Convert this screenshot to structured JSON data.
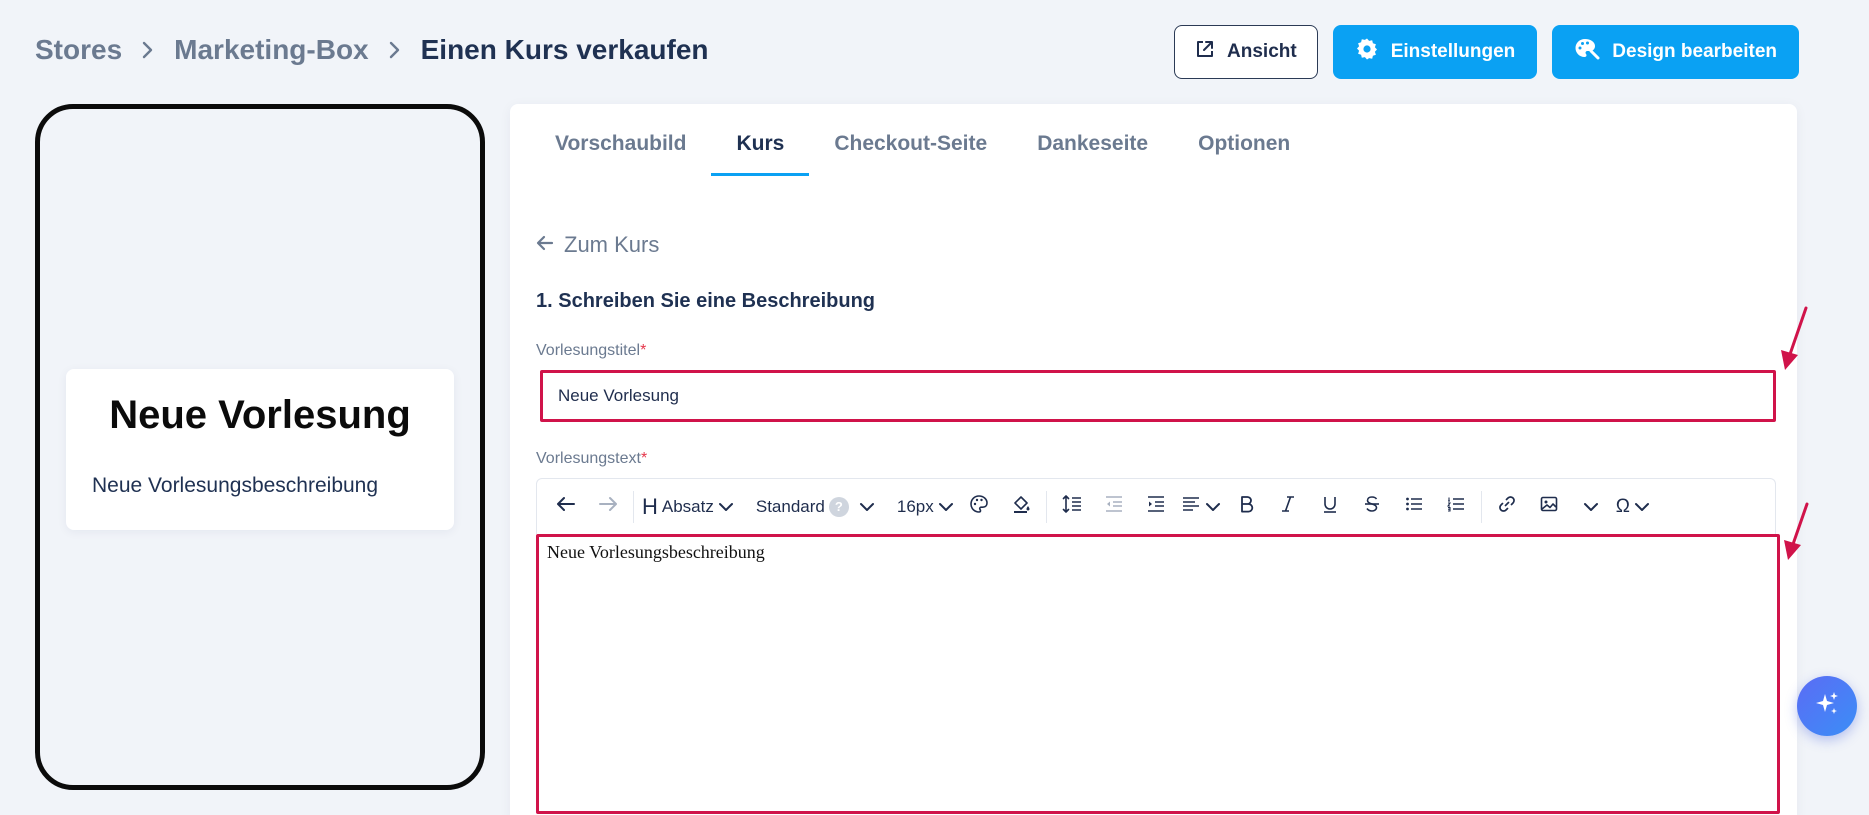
{
  "breadcrumb": {
    "items": [
      "Stores",
      "Marketing-Box",
      "Einen Kurs verkaufen"
    ]
  },
  "header": {
    "view_label": "Ansicht",
    "settings_label": "Einstellungen",
    "design_label": "Design bearbeiten"
  },
  "preview": {
    "title": "Neue Vorlesung",
    "description": "Neue Vorlesungsbeschreibung"
  },
  "tabs": [
    {
      "label": "Vorschaubild",
      "active": false
    },
    {
      "label": "Kurs",
      "active": true
    },
    {
      "label": "Checkout-Seite",
      "active": false
    },
    {
      "label": "Dankeseite",
      "active": false
    },
    {
      "label": "Optionen",
      "active": false
    }
  ],
  "form": {
    "back_label": "Zum Kurs",
    "section_title": "1. Schreiben Sie eine Beschreibung",
    "title_label": "Vorlesungstitel",
    "required_mark": "*",
    "title_value": "Neue Vorlesung",
    "text_label": "Vorlesungstext",
    "text_value": "Neue Vorlesungsbeschreibung"
  },
  "toolbar": {
    "heading_icon": "H",
    "paragraph": "Absatz",
    "font": "Standard",
    "font_help": "?",
    "size": "16px",
    "omega": "Ω"
  },
  "colors": {
    "accent": "#0aa1f3",
    "highlight": "#d0134a",
    "text": "#1f3152",
    "muted": "#6b7a90"
  }
}
